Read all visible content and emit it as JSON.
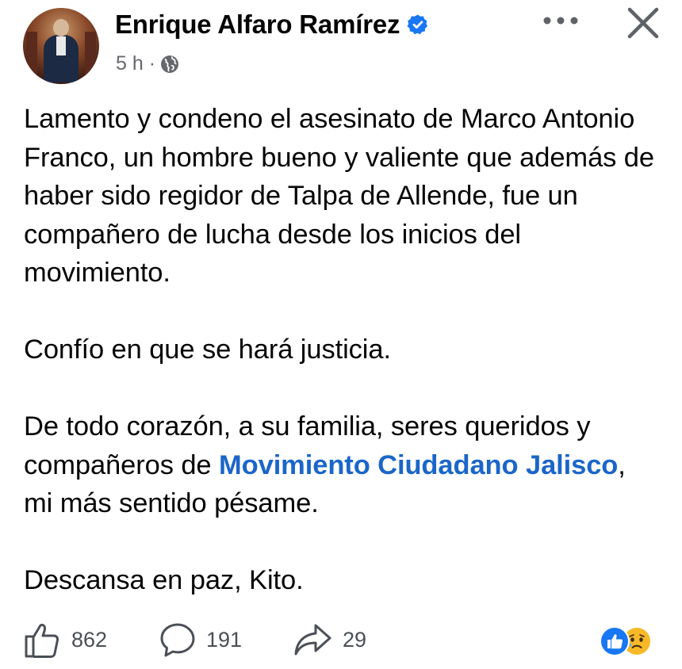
{
  "post": {
    "author": "Enrique Alfaro Ramírez",
    "time": "5 h",
    "separator": "·",
    "paragraphs": {
      "p1": "Lamento y condeno el asesinato de Marco Antonio Franco, un hombre bueno y valiente que además de haber sido regidor de Talpa de Allende, fue un compañero de lucha desde los inicios del movimiento.",
      "p2": "Confío en que se hará justicia.",
      "p3_before": "De todo corazón, a su familia, seres queridos y compañeros de ",
      "p3_mention": "Movimiento Ciudadano Jalisco",
      "p3_after": ", mi más sentido pésame.",
      "p4": "Descansa en paz, Kito."
    }
  },
  "stats": {
    "likes": "862",
    "comments": "191",
    "shares": "29"
  },
  "icons": {
    "verified": "verified-badge-icon",
    "audience": "globe-icon",
    "more": "more-horizontal-icon",
    "close": "close-icon",
    "like": "thumbs-up-icon",
    "comment": "comment-bubble-icon",
    "share": "share-arrow-icon",
    "reactions": [
      "like-reaction-icon",
      "sad-reaction-icon"
    ]
  },
  "colors": {
    "mention": "#1b66c9",
    "verified": "#1877f2",
    "meta": "#65676b"
  }
}
